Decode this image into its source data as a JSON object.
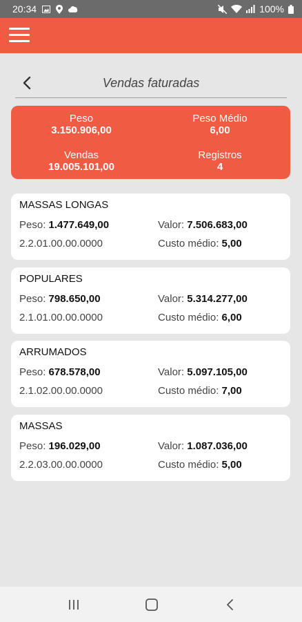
{
  "status": {
    "time": "20:34",
    "battery": "100%"
  },
  "icons": {
    "menu": "hamburger-menu-icon",
    "back": "chevron-left-icon",
    "recent_apps": "recent-apps-icon",
    "home": "home-icon",
    "nav_back": "nav-back-icon"
  },
  "colors": {
    "accent": "#ef5c43",
    "status_bar": "#6b6b6b",
    "background": "#e6e6e6"
  },
  "page": {
    "title": "Vendas faturadas"
  },
  "summary": {
    "peso_label": "Peso",
    "peso_value": "3.150.906,00",
    "peso_medio_label": "Peso Médio",
    "peso_medio_value": "6,00",
    "vendas_label": "Vendas",
    "vendas_value": "19.005.101,00",
    "registros_label": "Registros",
    "registros_value": "4"
  },
  "labels": {
    "peso": "Peso: ",
    "valor": "Valor: ",
    "custo": "Custo médio: "
  },
  "cards": [
    {
      "name": "MASSAS LONGAS",
      "peso": "1.477.649,00",
      "valor": "7.506.683,00",
      "code": "2.2.01.00.00.0000",
      "custo": "5,00"
    },
    {
      "name": "POPULARES",
      "peso": "798.650,00",
      "valor": "5.314.277,00",
      "code": "2.1.01.00.00.0000",
      "custo": "6,00"
    },
    {
      "name": "ARRUMADOS",
      "peso": "678.578,00",
      "valor": "5.097.105,00",
      "code": "2.1.02.00.00.0000",
      "custo": "7,00"
    },
    {
      "name": "MASSAS",
      "peso": "196.029,00",
      "valor": "1.087.036,00",
      "code": "2.2.03.00.00.0000",
      "custo": "5,00"
    }
  ]
}
